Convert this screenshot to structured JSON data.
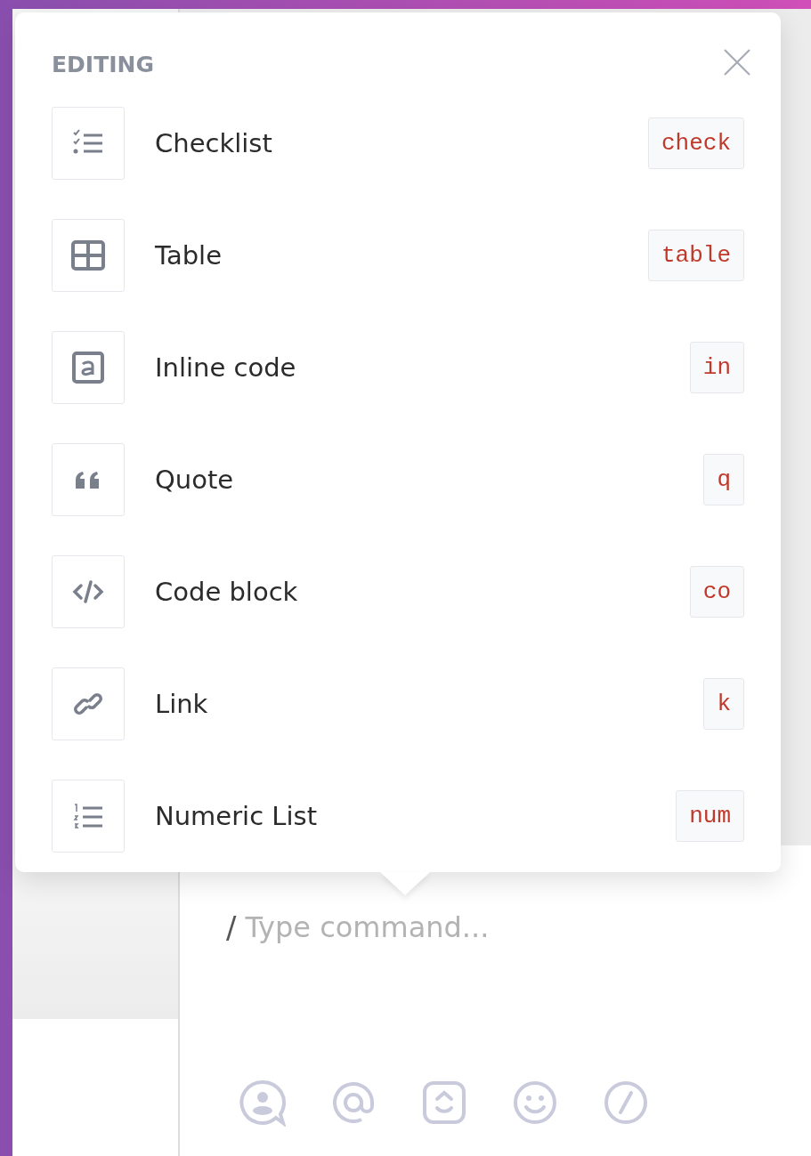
{
  "menu": {
    "heading": "EDITING",
    "items": [
      {
        "kind": "checklist",
        "label": "Checklist",
        "shortcut": "check"
      },
      {
        "kind": "table",
        "label": "Table",
        "shortcut": "table"
      },
      {
        "kind": "inline",
        "label": "Inline code",
        "shortcut": "in"
      },
      {
        "kind": "quote",
        "label": "Quote",
        "shortcut": "q"
      },
      {
        "kind": "code",
        "label": "Code block",
        "shortcut": "co"
      },
      {
        "kind": "link",
        "label": "Link",
        "shortcut": "k"
      },
      {
        "kind": "numbered",
        "label": "Numeric List",
        "shortcut": "num"
      }
    ]
  },
  "composer": {
    "prefix": "/",
    "placeholder": "Type command..."
  }
}
